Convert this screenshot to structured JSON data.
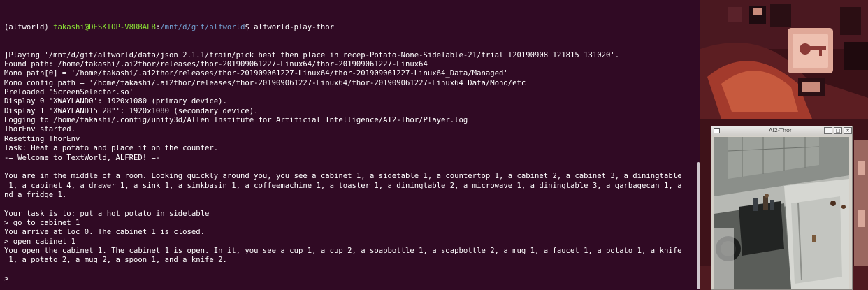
{
  "terminal": {
    "prompt": {
      "env": "(alfworld) ",
      "user_host": "takashi@DESKTOP-V8RBALB",
      "colon": ":",
      "path": "/mnt/d/git/alfworld",
      "symbol": "$ ",
      "command": "alfworld-play-thor"
    },
    "lines": [
      "]Playing '/mnt/d/git/alfworld/data/json_2.1.1/train/pick_heat_then_place_in_recep-Potato-None-SideTable-21/trial_T20190908_121815_131020'.",
      "Found path: /home/takashi/.ai2thor/releases/thor-201909061227-Linux64/thor-201909061227-Linux64",
      "Mono path[0] = '/home/takashi/.ai2thor/releases/thor-201909061227-Linux64/thor-201909061227-Linux64_Data/Managed'",
      "Mono config path = '/home/takashi/.ai2thor/releases/thor-201909061227-Linux64/thor-201909061227-Linux64_Data/Mono/etc'",
      "Preloaded 'ScreenSelector.so'",
      "Display 0 'XWAYLAND0': 1920x1080 (primary device).",
      "Display 1 'XWAYLAND15 28\"': 1920x1080 (secondary device).",
      "Logging to /home/takashi/.config/unity3d/Allen Institute for Artificial Intelligence/AI2-Thor/Player.log",
      "ThorEnv started.",
      "Resetting ThorEnv",
      "Task: Heat a potato and place it on the counter.",
      "-= Welcome to TextWorld, ALFRED! =-",
      "",
      "You are in the middle of a room. Looking quickly around you, you see a cabinet 1, a sidetable 1, a countertop 1, a cabinet 2, a cabinet 3, a diningtable",
      " 1, a cabinet 4, a drawer 1, a sink 1, a sinkbasin 1, a coffeemachine 1, a toaster 1, a diningtable 2, a microwave 1, a diningtable 3, a garbagecan 1, a",
      "nd a fridge 1.",
      "",
      "Your task is to: put a hot potato in sidetable",
      "> go to cabinet 1",
      "You arrive at loc 0. The cabinet 1 is closed.",
      "> open cabinet 1",
      "You open the cabinet 1. The cabinet 1 is open. In it, you see a cup 1, a cup 2, a soapbottle 1, a soapbottle 2, a mug 1, a faucet 1, a potato 1, a knife",
      " 1, a potato 2, a mug 2, a spoon 1, and a knife 2.",
      "",
      ">"
    ]
  },
  "ai2thor": {
    "title": "AI2-Thor",
    "minimize": "—",
    "maximize": "□",
    "close": "✕"
  },
  "colors": {
    "terminal_bg": "#300a24",
    "prompt_user": "#8ae234",
    "prompt_path": "#729fcf"
  }
}
